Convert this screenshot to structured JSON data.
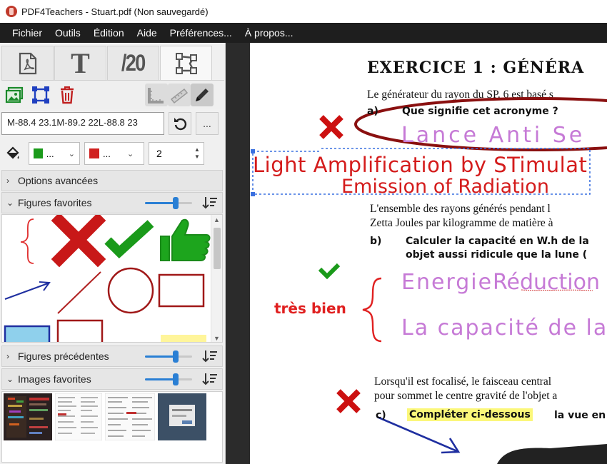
{
  "window": {
    "title": "PDF4Teachers - Stuart.pdf (Non sauvegardé)"
  },
  "menu": [
    "Fichier",
    "Outils",
    "Édition",
    "Aide",
    "Préférences...",
    "À propos..."
  ],
  "sidebar": {
    "tabs": [
      {
        "icon": "pdf-file-icon"
      },
      {
        "label": "T",
        "icon": "text-tab-icon"
      },
      {
        "label": "/20",
        "icon": "grades-tab-icon"
      },
      {
        "icon": "vector-shape-icon",
        "active": true
      }
    ],
    "tools": [
      "image-add-icon",
      "vector-select-icon",
      "delete-icon",
      "ruler-icon",
      "measure-icon",
      "pen-icon"
    ],
    "path_value": "M-88.4 23.1M-89.2 22L-88.8 23",
    "more_label": "...",
    "fill_color": "#1a9a1a",
    "stroke_color": "#d0201f",
    "fill_label": "...",
    "stroke_label": "...",
    "stroke_width": "2",
    "sections": {
      "advanced": "Options avancées",
      "favorites": "Figures favorites",
      "previous": "Figures précédentes",
      "images": "Images favorites"
    },
    "favorites_slider": 0.65,
    "previous_slider": 0.65,
    "images_slider": 0.65,
    "favorite_figures": [
      "brace",
      "red-cross",
      "green-check",
      "thumbs-up",
      "arrow",
      "line",
      "circle",
      "rectangle",
      "blue-filled-rectangle",
      "red-rectangle",
      "yellow-highlight"
    ]
  },
  "document": {
    "title": "EXERCICE 1 : GÉNÉRA",
    "line1": "Le générateur du rayon du SP. 6 est basé s",
    "qa_label": "a)",
    "qa_text": "Que signifie cet acronyme ?",
    "hw_answer1": "Lance  Anti  Se",
    "hw_answer2a": "Light Amplification by STimulat",
    "hw_answer2b": "Emission of Radiation",
    "line2": "L'ensemble des rayons générés pendant l",
    "line3": "Zetta Joules par kilogramme de matière à",
    "qb_label": "b)",
    "qb_text1": "Calculer la capacité en W.h de la",
    "qb_text2": "objet aussi ridicule que la lune (",
    "hw_energie_a": "Energie",
    "hw_energie_b": "Réduction L",
    "hw_capacite": "La capacité de la",
    "tres_bien": "très bien",
    "line4": "Lorsqu'il est focalisé, le faisceau central",
    "line5": "pour sommet le centre gravité de l'objet a",
    "qc_label": "c)",
    "qc_highlight": "Compléter ci-dessous",
    "qc_rest": "la vue en"
  }
}
